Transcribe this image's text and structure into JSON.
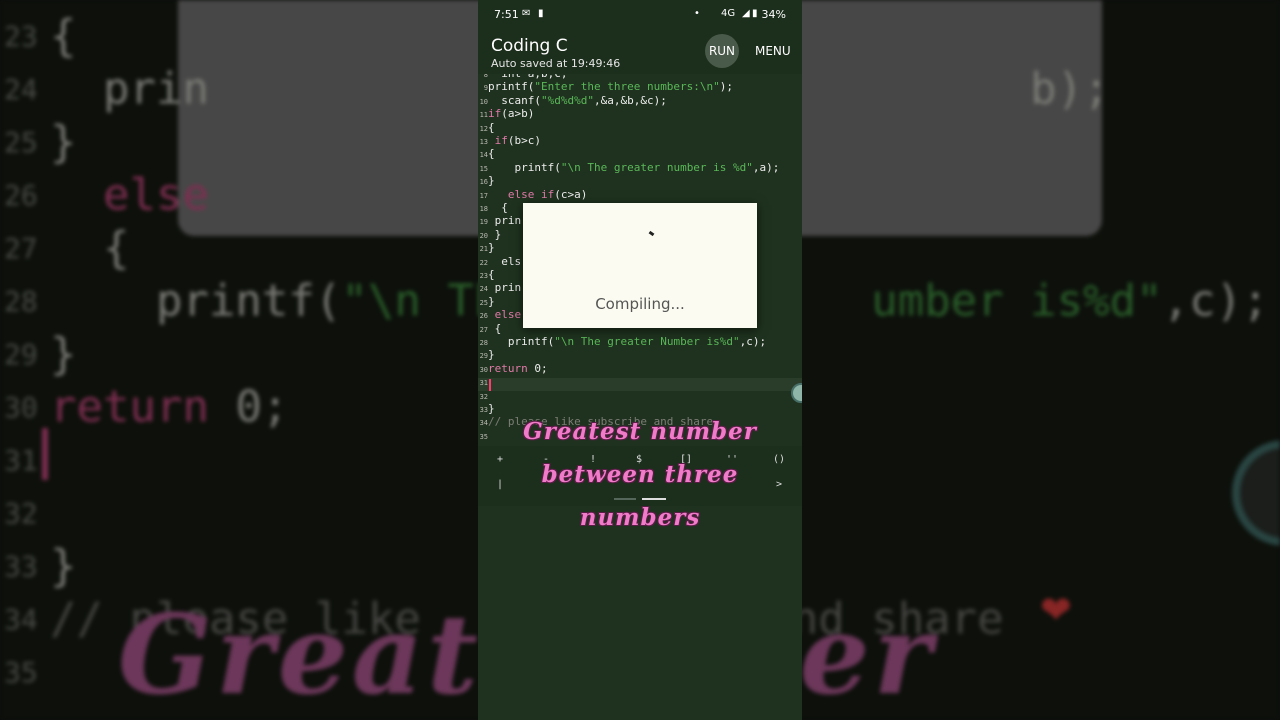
{
  "status_bar": {
    "time": "7:51",
    "network": "4G",
    "battery": "34%"
  },
  "app": {
    "title": "Coding C",
    "autosave": "Auto saved at 19:49:46",
    "run_label": "RUN",
    "menu_label": "MENU"
  },
  "editor": {
    "lines": [
      {
        "n": "8",
        "code": "  int a,b,c;"
      },
      {
        "n": "9",
        "code": "printf(\"Enter the three numbers:\\n\");"
      },
      {
        "n": "10",
        "code": "  scanf(\"%d%d%d\",&a,&b,&c);"
      },
      {
        "n": "11",
        "code": "if(a>b)"
      },
      {
        "n": "12",
        "code": "{"
      },
      {
        "n": "13",
        "code": " if(b>c)"
      },
      {
        "n": "14",
        "code": "{"
      },
      {
        "n": "15",
        "code": "    printf(\"\\n The greater number is %d\",a);"
      },
      {
        "n": "16",
        "code": "}"
      },
      {
        "n": "17",
        "code": "   else if(c>a)"
      },
      {
        "n": "18",
        "code": "  {"
      },
      {
        "n": "19",
        "code": " prin                           c);"
      },
      {
        "n": "20",
        "code": " }"
      },
      {
        "n": "21",
        "code": "}"
      },
      {
        "n": "22",
        "code": "  els                            ock"
      },
      {
        "n": "23",
        "code": "{"
      },
      {
        "n": "24",
        "code": " prin                           b);"
      },
      {
        "n": "25",
        "code": "}"
      },
      {
        "n": "26",
        "code": " else"
      },
      {
        "n": "27",
        "code": " {"
      },
      {
        "n": "28",
        "code": "   printf(\"\\n The greater Number is%d\",c);"
      },
      {
        "n": "29",
        "code": "}"
      },
      {
        "n": "30",
        "code": "return 0;"
      },
      {
        "n": "31",
        "code": ""
      },
      {
        "n": "32",
        "code": ""
      },
      {
        "n": "33",
        "code": "}"
      },
      {
        "n": "34",
        "code": "// please like subscribe and share"
      },
      {
        "n": "35",
        "code": ""
      }
    ]
  },
  "dialog": {
    "message": "Compiling..."
  },
  "keyboard": {
    "row1": [
      "+",
      "-",
      "!",
      "$",
      "[]",
      "''",
      "()"
    ],
    "row2": [
      "|",
      ">"
    ]
  },
  "caption": {
    "line1": "Greatest number",
    "line2": "between three",
    "line3": "numbers"
  },
  "background": {
    "lines": [
      {
        "n": "23",
        "code": "{"
      },
      {
        "n": "24",
        "code": "  prin                               b);"
      },
      {
        "n": "25",
        "code": "}"
      },
      {
        "n": "26",
        "code": "  else"
      },
      {
        "n": "27",
        "code": "  {"
      },
      {
        "n": "28",
        "code": "    printf(\"\\n Th              umber is%d\",c);"
      },
      {
        "n": "29",
        "code": "}"
      },
      {
        "n": "30",
        "code": "return 0;"
      },
      {
        "n": "31",
        "code": ""
      },
      {
        "n": "32",
        "code": ""
      },
      {
        "n": "33",
        "code": "}"
      },
      {
        "n": "34",
        "code": "// please like              nd share"
      },
      {
        "n": "35",
        "code": ""
      }
    ],
    "caption": "Greate               mber"
  },
  "colors": {
    "editor_bg": "#1f321f",
    "keyword": "#e07aa8",
    "string": "#5ab858",
    "caption": "#f07bc8"
  }
}
